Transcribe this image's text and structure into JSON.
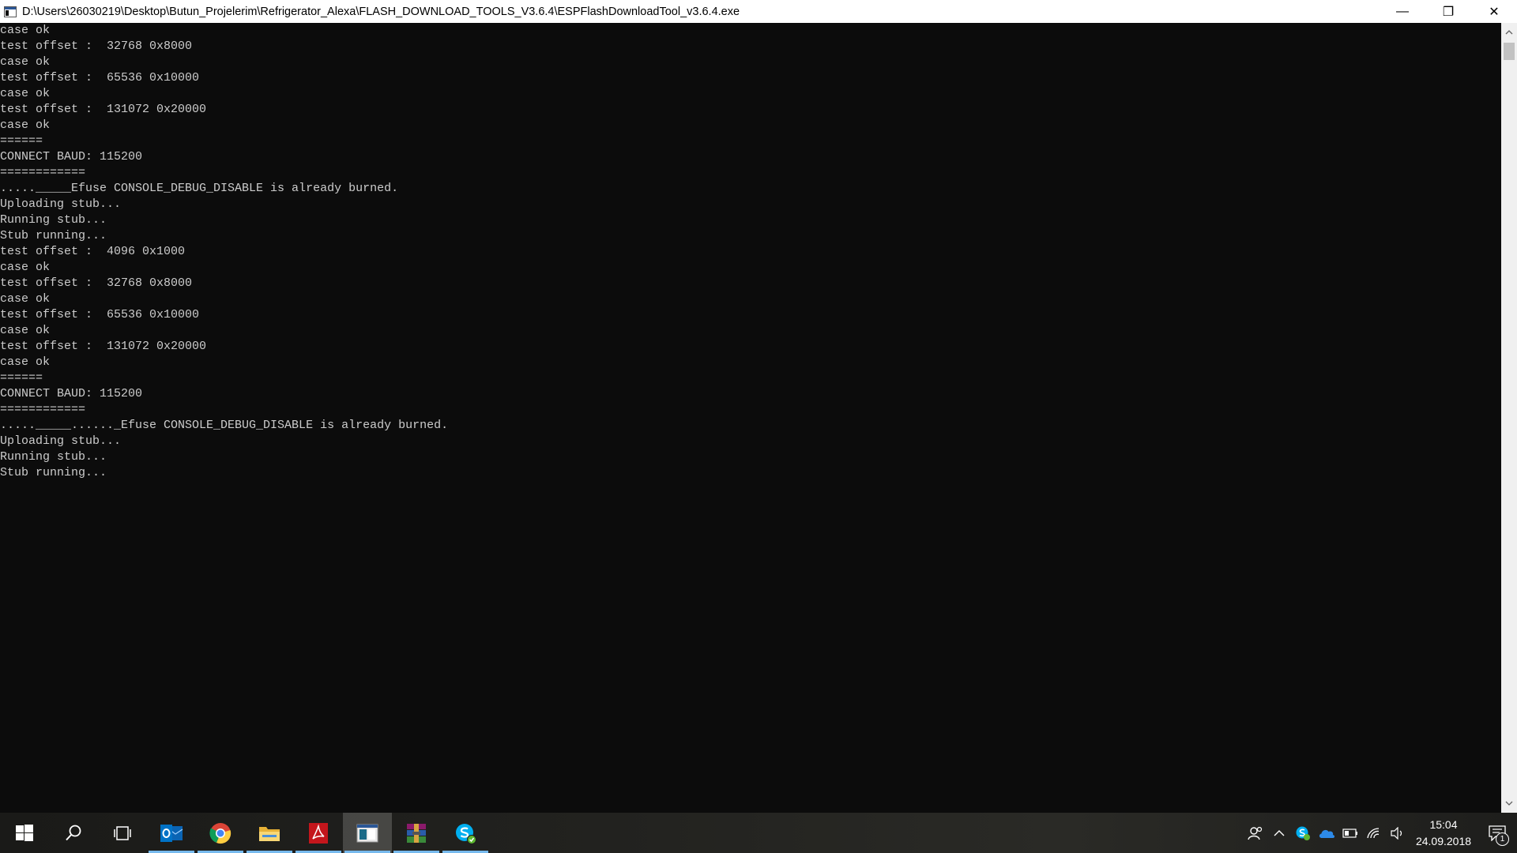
{
  "window": {
    "title": "D:\\Users\\26030219\\Desktop\\Butun_Projelerim\\Refrigerator_Alexa\\FLASH_DOWNLOAD_TOOLS_V3.6.4\\ESPFlashDownloadTool_v3.6.4.exe",
    "minimize_glyph": "—",
    "restore_glyph": "❐",
    "close_glyph": "✕"
  },
  "console": {
    "lines": [
      "case ok",
      "test offset :  32768 0x8000",
      "case ok",
      "test offset :  65536 0x10000",
      "case ok",
      "test offset :  131072 0x20000",
      "case ok",
      "======",
      "CONNECT BAUD: 115200",
      "============",
      "....._____Efuse CONSOLE_DEBUG_DISABLE is already burned.",
      "Uploading stub...",
      "Running stub...",
      "Stub running...",
      "test offset :  4096 0x1000",
      "case ok",
      "test offset :  32768 0x8000",
      "case ok",
      "test offset :  65536 0x10000",
      "case ok",
      "test offset :  131072 0x20000",
      "case ok",
      "======",
      "CONNECT BAUD: 115200",
      "============",
      "....._____......_Efuse CONSOLE_DEBUG_DISABLE is already burned.",
      "Uploading stub...",
      "Running stub...",
      "Stub running..."
    ]
  },
  "taskbar": {
    "apps": [
      {
        "name": "start",
        "icon": "windows-logo-icon",
        "running": false
      },
      {
        "name": "search",
        "icon": "search-icon",
        "running": false
      },
      {
        "name": "task-view",
        "icon": "task-view-icon",
        "running": false
      },
      {
        "name": "outlook",
        "icon": "outlook-icon",
        "running": true
      },
      {
        "name": "chrome",
        "icon": "chrome-icon",
        "running": true
      },
      {
        "name": "file-explorer",
        "icon": "folder-icon",
        "running": true
      },
      {
        "name": "acrobat",
        "icon": "pdf-icon",
        "running": true
      },
      {
        "name": "flash-tool",
        "icon": "console-app-icon",
        "running": true
      },
      {
        "name": "winrar",
        "icon": "winrar-icon",
        "running": true
      },
      {
        "name": "skype",
        "icon": "skype-icon",
        "running": true
      }
    ],
    "clock": {
      "time": "15:04",
      "date": "24.09.2018"
    },
    "notification_count": "1",
    "colors": {
      "accent": "#76b9ed",
      "outlook": "#0072c6",
      "acrobat": "#c4161c",
      "skype": "#00aff0"
    }
  }
}
